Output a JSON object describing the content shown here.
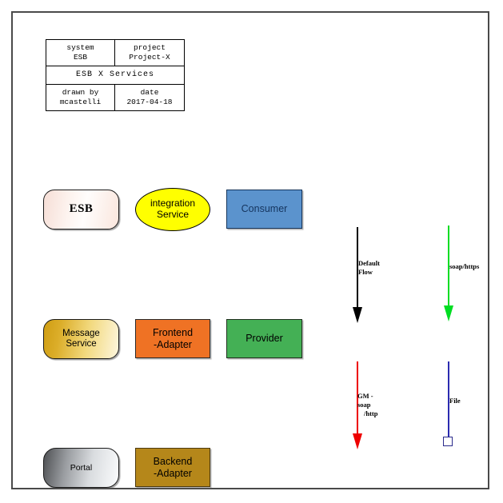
{
  "diagram": {
    "title_block": {
      "rows": [
        {
          "cells": [
            {
              "label": "system",
              "value": "ESB"
            },
            {
              "label": "project",
              "value": "Project-X"
            }
          ]
        },
        {
          "cells": [
            {
              "label": "ESB X Services",
              "value": ""
            }
          ]
        },
        {
          "cells": [
            {
              "label": "drawn by",
              "value": "mcastelli"
            },
            {
              "label": "date",
              "value": "2017-04-18"
            }
          ]
        }
      ]
    },
    "shapes": [
      {
        "id": "esb",
        "label": "ESB",
        "shape": "rounded-rect",
        "fill": "#fdf4f0"
      },
      {
        "id": "integration-service",
        "label": "integration\nService",
        "shape": "ellipse",
        "fill": "#ffff00"
      },
      {
        "id": "consumer",
        "label": "Consumer",
        "shape": "rect",
        "fill": "#5b93cd"
      },
      {
        "id": "message-service",
        "label": "Message\nService",
        "shape": "rounded-rect",
        "fill": "#dcae2a"
      },
      {
        "id": "frontend-adapter",
        "label": "Frontend\n-Adapter",
        "shape": "rect",
        "fill": "#ef7224"
      },
      {
        "id": "provider",
        "label": "Provider",
        "shape": "rect",
        "fill": "#44b055"
      },
      {
        "id": "portal",
        "label": "Portal",
        "shape": "rounded-rect",
        "fill": "#9a9da1"
      },
      {
        "id": "backend-adapter",
        "label": "Backend\n-Adapter",
        "shape": "rect",
        "fill": "#b5871a"
      }
    ],
    "connectors": [
      {
        "id": "default-flow",
        "label": "Default\nFlow",
        "color": "#000000",
        "end": "arrow"
      },
      {
        "id": "soap-https",
        "label": "soap/https",
        "color": "#00dd22",
        "end": "arrow"
      },
      {
        "id": "gm-soap-http",
        "label_line1": "GM - soap",
        "label_line2": "/http",
        "color": "#ee0000",
        "end": "arrow"
      },
      {
        "id": "file",
        "label": "File",
        "color": "#2b2bb0",
        "end": "square"
      }
    ]
  }
}
